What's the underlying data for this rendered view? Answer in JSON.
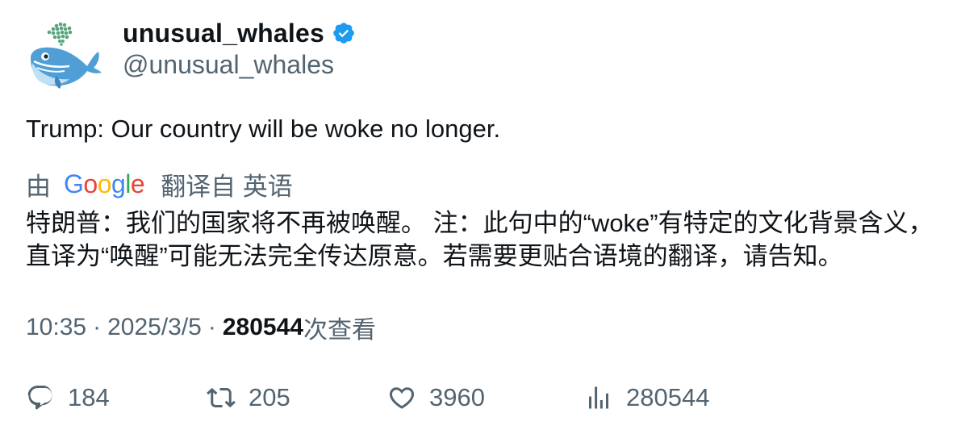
{
  "author": {
    "display_name": "unusual_whales",
    "handle": "@unusual_whales",
    "verified": true,
    "verified_color": "#1d9bf0"
  },
  "tweet": {
    "text": "Trump: Our country will be woke no longer."
  },
  "translation": {
    "by_label": "由",
    "provider": "Google",
    "provider_colors": [
      "#4285F4",
      "#EA4335",
      "#FBBC05",
      "#4285F4",
      "#34A853",
      "#EA4335"
    ],
    "source_label": "翻译自 英语",
    "translated_text": "特朗普：我们的国家将不再被唤醒。 注：此句中的“woke”有特定的文化背景含义，直译为“唤醒”可能无法完全传达原意。若需要更贴合语境的翻译，请告知。"
  },
  "meta": {
    "time": "10:35",
    "separator": "·",
    "date": "2025/3/5",
    "views_count": "280544",
    "views_label": "次查看"
  },
  "actions": {
    "replies": "184",
    "retweets": "205",
    "likes": "3960",
    "views": "280544"
  }
}
